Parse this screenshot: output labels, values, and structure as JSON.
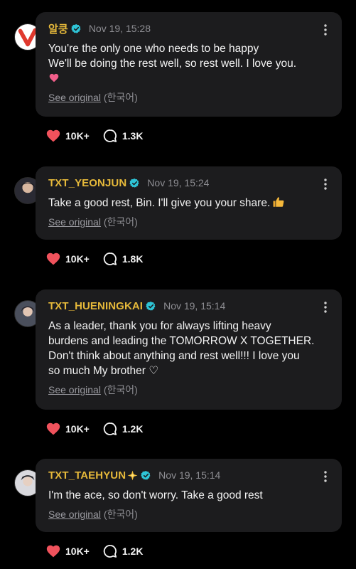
{
  "posts": [
    {
      "author": "알쿵",
      "time": "Nov 19, 15:28",
      "lines": [
        "You're the only one who needs to be happy",
        "We'll be doing the rest well, so rest well. I love you."
      ],
      "see_original": "See original",
      "lang": "(한국어)",
      "likes": "10K+",
      "comments": "1.3K"
    },
    {
      "author": "TXT_YEONJUN",
      "time": "Nov 19, 15:24",
      "lines": [
        "Take a good rest, Bin. I'll give you your share."
      ],
      "see_original": "See original",
      "lang": "(한국어)",
      "likes": "10K+",
      "comments": "1.8K"
    },
    {
      "author": "TXT_HUENINGKAI",
      "time": "Nov 19, 15:14",
      "lines": [
        "As a leader, thank you for always lifting heavy",
        "burdens and leading the TOMORROW X TOGETHER.",
        "Don't think about anything and rest well!!! I love you",
        "so much My brother ♡"
      ],
      "see_original": "See original",
      "lang": "(한국어)",
      "likes": "10K+",
      "comments": "1.2K"
    },
    {
      "author": "TXT_TAEHYUN",
      "time": "Nov 19, 15:14",
      "lines": [
        "I'm the ace, so don't worry. Take a good rest"
      ],
      "see_original": "See original",
      "lang": "(한국어)",
      "likes": "10K+",
      "comments": "1.2K"
    }
  ],
  "colors": {
    "background": "#000000",
    "card": "#1c1c1e",
    "author": "#e6b93a",
    "verified": "#2ec4d6",
    "like": "#f0525c",
    "muted": "#8e8e93"
  },
  "icons": [
    "verified-badge-icon",
    "more-options-icon",
    "heart-icon",
    "comment-icon",
    "thumbs-up-emoji-icon",
    "sparkle-emoji-icon",
    "pink-heart-emoji-icon"
  ]
}
